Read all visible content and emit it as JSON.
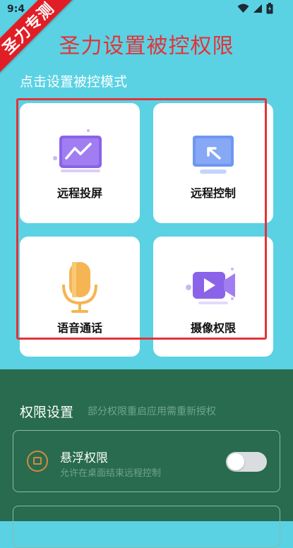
{
  "status_bar": {
    "time": "9:4"
  },
  "ribbon": {
    "text": "圣力专测"
  },
  "app_title": "圣力设置被控权限",
  "section_label": "点击设置被控模式",
  "cards": [
    {
      "label": "远程投屏",
      "icon": "screen-cast-icon"
    },
    {
      "label": "远程控制",
      "icon": "remote-control-icon"
    },
    {
      "label": "语音通话",
      "icon": "microphone-icon"
    },
    {
      "label": "摄像权限",
      "icon": "video-camera-icon"
    }
  ],
  "permissions": {
    "title": "权限设置",
    "note": "部分权限重启应用需重新授权",
    "items": [
      {
        "name": "悬浮权限",
        "desc": "允许在桌面结束远程控制",
        "enabled": false
      }
    ]
  },
  "colors": {
    "background": "#5ad2e3",
    "accent_red": "#e53238",
    "panel_green": "#286b4e"
  }
}
